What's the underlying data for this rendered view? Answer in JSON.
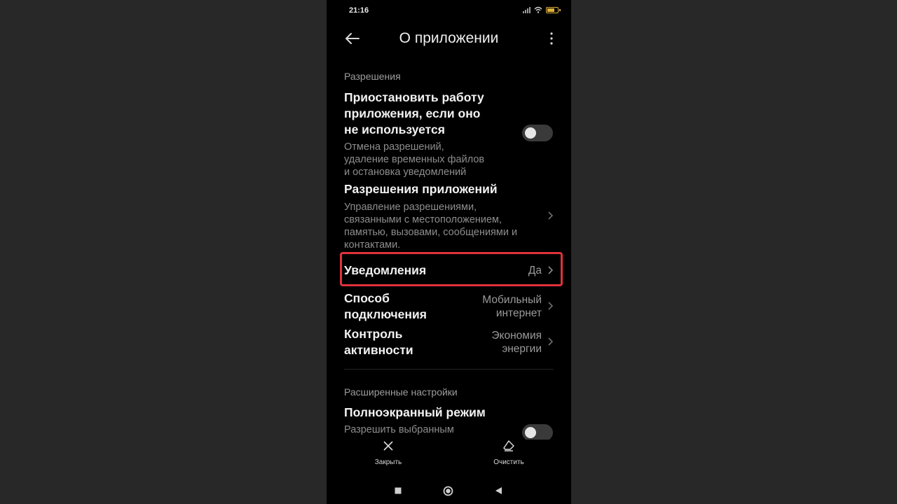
{
  "status_bar": {
    "time": "21:16",
    "icons": [
      "signal-icon",
      "wifi-icon",
      "battery-icon"
    ],
    "battery_color": "#e0b23a"
  },
  "app_bar": {
    "title": "О приложении",
    "back_icon": "arrow-left-icon",
    "menu_icon": "more-vertical-icon"
  },
  "permissions": {
    "header": "Разрешения",
    "pause_app": {
      "title_lines": [
        "Приостановить работу",
        "приложения, если оно",
        "не используется"
      ],
      "subtitle_lines": [
        "Отмена разрешений,",
        "удаление временных файлов",
        "и остановка уведомлений"
      ],
      "toggle_on": false
    },
    "app_permissions": {
      "title": "Разрешения приложений",
      "subtitle_lines": [
        "Управление разрешениями,",
        "связанными с местоположением,",
        "памятью, вызовами, сообщениями и",
        "контактами."
      ]
    },
    "notifications": {
      "title": "Уведомления",
      "value": "Да",
      "highlight_color": "#e0313a"
    },
    "connection": {
      "title_lines": [
        "Способ",
        "подключения"
      ],
      "value_lines": [
        "Мобильный",
        "интернет"
      ]
    },
    "activity": {
      "title_lines": [
        "Контроль",
        "активности"
      ],
      "value_lines": [
        "Экономия",
        "энергии"
      ]
    }
  },
  "advanced": {
    "header": "Расширенные настройки",
    "fullscreen": {
      "title": "Полноэкранный режим",
      "subtitle": "Разрешить выбранным",
      "toggle_on": false
    }
  },
  "bottom_actions": {
    "close_label": "Закрыть",
    "clear_label": "Очистить"
  },
  "nav_bar": {
    "icons": [
      "recents-square-icon",
      "home-circle-icon",
      "back-triangle-icon"
    ]
  }
}
